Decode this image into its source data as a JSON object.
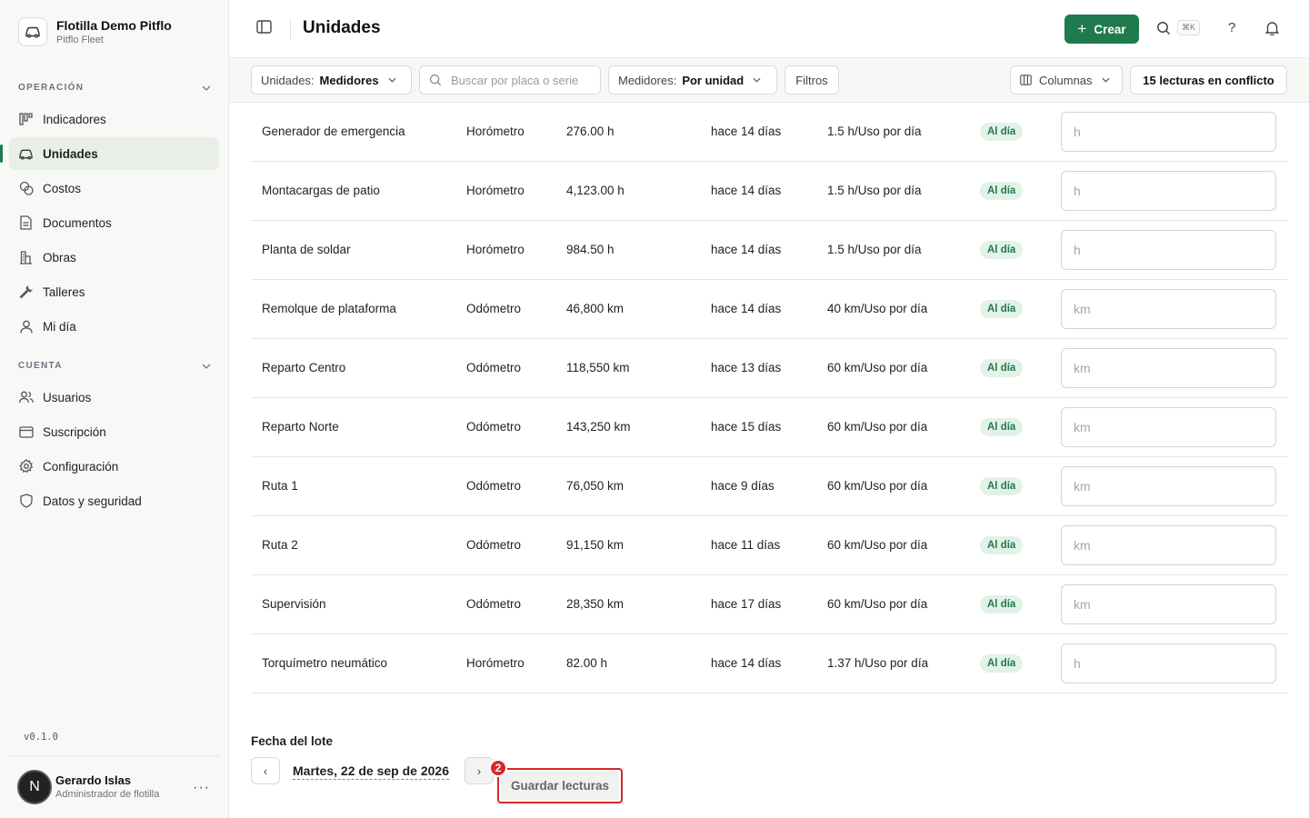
{
  "org": {
    "name": "Flotilla Demo Pitflo",
    "subtitle": "Pitflo Fleet"
  },
  "sidebar": {
    "section_operation": "OPERACIÓN",
    "operation_items": [
      {
        "label": "Indicadores",
        "icon": "chart-icon"
      },
      {
        "label": "Unidades",
        "icon": "car-icon"
      },
      {
        "label": "Costos",
        "icon": "coins-icon"
      },
      {
        "label": "Documentos",
        "icon": "document-icon"
      },
      {
        "label": "Obras",
        "icon": "building-icon"
      },
      {
        "label": "Talleres",
        "icon": "wrench-icon"
      },
      {
        "label": "Mi día",
        "icon": "person-icon"
      }
    ],
    "section_account": "CUENTA",
    "account_items": [
      {
        "label": "Usuarios",
        "icon": "users-icon"
      },
      {
        "label": "Suscripción",
        "icon": "card-icon"
      },
      {
        "label": "Configuración",
        "icon": "gear-icon"
      },
      {
        "label": "Datos y seguridad",
        "icon": "shield-icon"
      }
    ],
    "version": "v0.1.0"
  },
  "user": {
    "initial": "N",
    "name": "Gerardo Islas",
    "role": "Administrador de flotilla",
    "more": "···"
  },
  "header": {
    "title": "Unidades",
    "create_label": "Crear",
    "shortcut": "⌘K",
    "help": "?"
  },
  "toolbar": {
    "units_label": "Unidades:",
    "units_value": "Medidores",
    "search_placeholder": "Buscar por placa o serie",
    "meters_label": "Medidores:",
    "meters_value": "Por unidad",
    "filters": "Filtros",
    "columns": "Columnas",
    "conflicts": "15 lecturas en conflicto"
  },
  "rows": [
    {
      "name": "Generador de emergencia",
      "type": "Horómetro",
      "value": "276.00 h",
      "last": "hace 14 días",
      "rate": "1.5 h/Uso por día",
      "status": "Al día",
      "placeholder": "h"
    },
    {
      "name": "Montacargas de patio",
      "type": "Horómetro",
      "value": "4,123.00 h",
      "last": "hace 14 días",
      "rate": "1.5 h/Uso por día",
      "status": "Al día",
      "placeholder": "h"
    },
    {
      "name": "Planta de soldar",
      "type": "Horómetro",
      "value": "984.50 h",
      "last": "hace 14 días",
      "rate": "1.5 h/Uso por día",
      "status": "Al día",
      "placeholder": "h"
    },
    {
      "name": "Remolque de plataforma",
      "type": "Odómetro",
      "value": "46,800 km",
      "last": "hace 14 días",
      "rate": "40 km/Uso por día",
      "status": "Al día",
      "placeholder": "km"
    },
    {
      "name": "Reparto Centro",
      "type": "Odómetro",
      "value": "118,550 km",
      "last": "hace 13 días",
      "rate": "60 km/Uso por día",
      "status": "Al día",
      "placeholder": "km"
    },
    {
      "name": "Reparto Norte",
      "type": "Odómetro",
      "value": "143,250 km",
      "last": "hace 15 días",
      "rate": "60 km/Uso por día",
      "status": "Al día",
      "placeholder": "km"
    },
    {
      "name": "Ruta 1",
      "type": "Odómetro",
      "value": "76,050 km",
      "last": "hace 9 días",
      "rate": "60 km/Uso por día",
      "status": "Al día",
      "placeholder": "km"
    },
    {
      "name": "Ruta 2",
      "type": "Odómetro",
      "value": "91,150 km",
      "last": "hace 11 días",
      "rate": "60 km/Uso por día",
      "status": "Al día",
      "placeholder": "km"
    },
    {
      "name": "Supervisión",
      "type": "Odómetro",
      "value": "28,350 km",
      "last": "hace 17 días",
      "rate": "60 km/Uso por día",
      "status": "Al día",
      "placeholder": "km"
    },
    {
      "name": "Torquímetro neumático",
      "type": "Horómetro",
      "value": "82.00 h",
      "last": "hace 14 días",
      "rate": "1.37 h/Uso por día",
      "status": "Al día",
      "placeholder": "h"
    }
  ],
  "footer": {
    "batch_label": "Fecha del lote",
    "prev": "‹",
    "next": "›",
    "date": "Martes, 22 de sep de 2026",
    "step": "2",
    "save_label": "Guardar lecturas"
  }
}
